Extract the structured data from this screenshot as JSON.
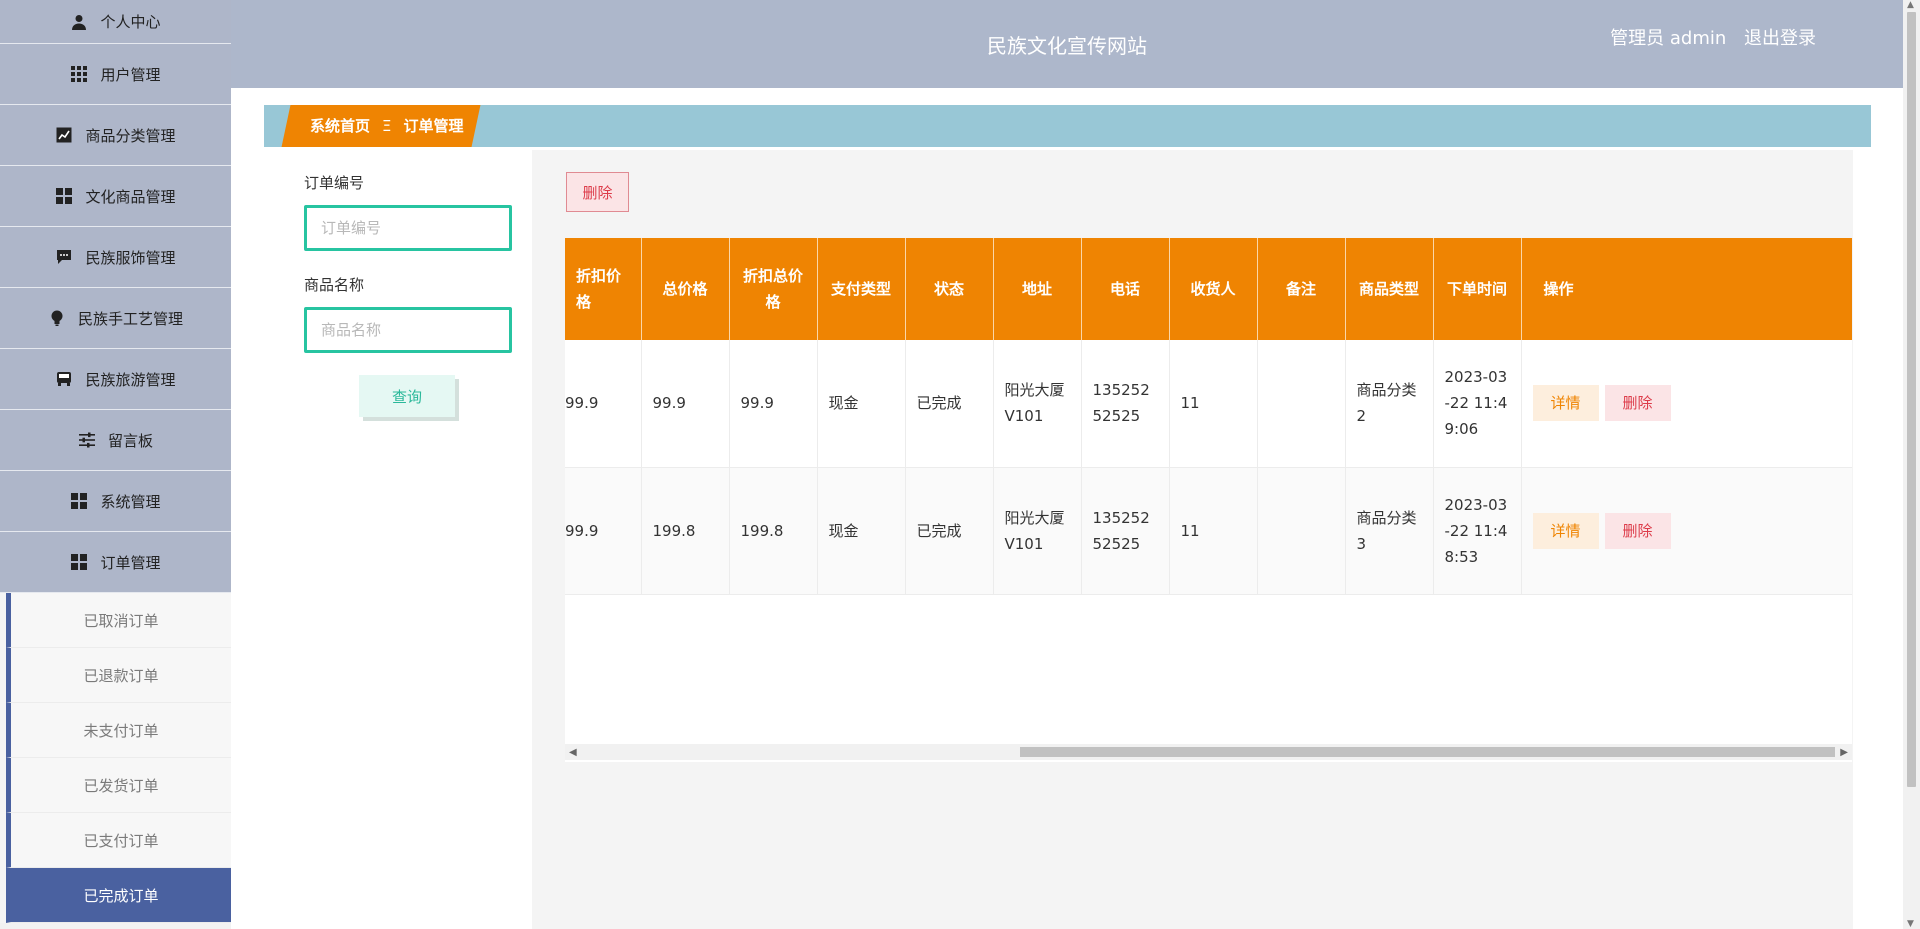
{
  "sidebar": {
    "menu": [
      {
        "label": "个人中心",
        "icon": "person-icon"
      },
      {
        "label": "用户管理",
        "icon": "grid-icon"
      },
      {
        "label": "商品分类管理",
        "icon": "chart-icon"
      },
      {
        "label": "文化商品管理",
        "icon": "tiles-icon"
      },
      {
        "label": "民族服饰管理",
        "icon": "chat-icon"
      },
      {
        "label": "民族手工艺管理",
        "icon": "bulb-icon"
      },
      {
        "label": "民族旅游管理",
        "icon": "bus-icon"
      },
      {
        "label": "留言板",
        "icon": "sliders-icon"
      },
      {
        "label": "系统管理",
        "icon": "tiles-icon"
      },
      {
        "label": "订单管理",
        "icon": "tiles-icon"
      }
    ],
    "submenu": [
      {
        "label": "已取消订单",
        "active": false
      },
      {
        "label": "已退款订单",
        "active": false
      },
      {
        "label": "未支付订单",
        "active": false
      },
      {
        "label": "已发货订单",
        "active": false
      },
      {
        "label": "已支付订单",
        "active": false
      },
      {
        "label": "已完成订单",
        "active": true
      }
    ]
  },
  "header": {
    "title": "民族文化宣传网站",
    "user": "管理员 admin",
    "logout": "退出登录"
  },
  "breadcrumb": {
    "home": "系统首页",
    "separator": "Ξ",
    "current": "订单管理"
  },
  "search": {
    "order_no_label": "订单编号",
    "order_no_placeholder": "订单编号",
    "product_name_label": "商品名称",
    "product_name_placeholder": "商品名称",
    "query_label": "查询"
  },
  "toolbar": {
    "delete_label": "删除"
  },
  "table": {
    "columns": [
      "折扣价格",
      "总价格",
      "折扣总价格",
      "支付类型",
      "状态",
      "地址",
      "电话",
      "收货人",
      "备注",
      "商品类型",
      "下单时间",
      "操作"
    ],
    "rows": [
      [
        "99.9",
        "99.9",
        "99.9",
        "现金",
        "已完成",
        "阳光大厦V101",
        "13525252525",
        "11",
        "",
        "商品分类2",
        "2023-03-22 11:49:06"
      ],
      [
        "99.9",
        "199.8",
        "199.8",
        "现金",
        "已完成",
        "阳光大厦V101",
        "13525252525",
        "11",
        "",
        "商品分类3",
        "2023-03-22 11:48:53"
      ]
    ],
    "detail_label": "详情",
    "row_delete_label": "删除"
  },
  "colors": {
    "accent": "#ef8402",
    "sidebar": "#aeb6c9",
    "active": "#4a61a0",
    "teal": "#27c4a1",
    "crumb_bar": "#98c7d6"
  }
}
